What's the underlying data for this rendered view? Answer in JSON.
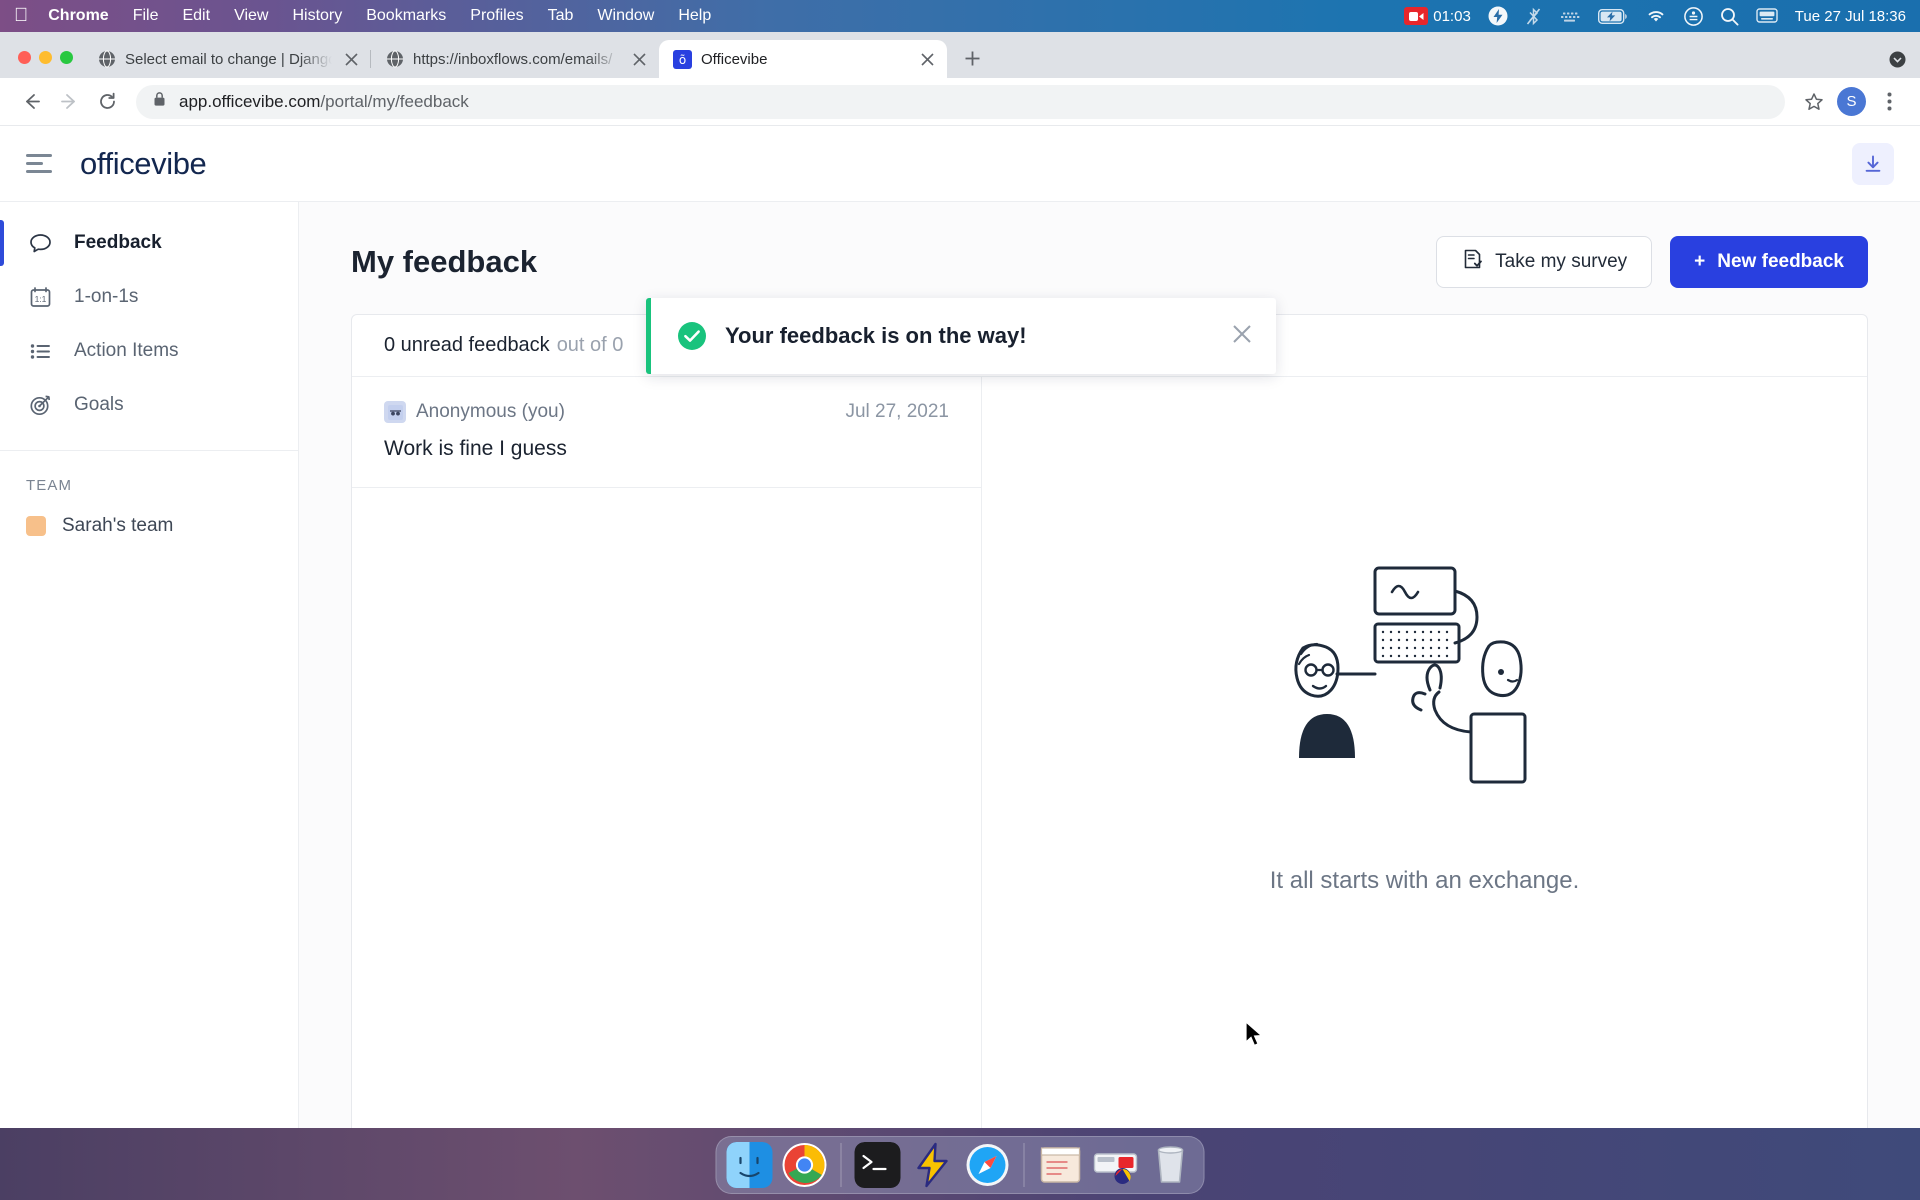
{
  "menubar": {
    "apple_icon": "apple-logo-icon",
    "items": [
      {
        "label": "Chrome",
        "bold": true
      },
      {
        "label": "File",
        "bold": false
      },
      {
        "label": "Edit",
        "bold": false
      },
      {
        "label": "View",
        "bold": false
      },
      {
        "label": "History",
        "bold": false
      },
      {
        "label": "Bookmarks",
        "bold": false
      },
      {
        "label": "Profiles",
        "bold": false
      },
      {
        "label": "Tab",
        "bold": false
      },
      {
        "label": "Window",
        "bold": false
      },
      {
        "label": "Help",
        "bold": false
      }
    ],
    "recording_time": "01:03",
    "status_icons": [
      "screen-recording-icon",
      "flash-icon",
      "bluetooth-off-icon",
      "keyboard-brightness-icon",
      "battery-charging-icon",
      "wifi-icon",
      "control-center-icon",
      "search-icon",
      "siri-icon"
    ],
    "clock": "Tue 27 Jul  18:36"
  },
  "browser": {
    "tabs": [
      {
        "title": "Select email to change | Django",
        "favicon": "globe-icon",
        "active": false
      },
      {
        "title": "https://inboxflows.com/emails/",
        "favicon": "globe-icon",
        "active": false
      },
      {
        "title": "Officevibe",
        "favicon": "officevibe-favicon",
        "active": true
      }
    ],
    "new_tab_label": "+",
    "url_host": "app.officevibe.com",
    "url_path": "/portal/my/feedback",
    "profile_initial": "S",
    "toolbar_icons": [
      "back-icon",
      "forward-icon",
      "reload-icon",
      "lock-icon",
      "bookmark-star-icon",
      "chrome-menu-icon"
    ]
  },
  "app": {
    "brand": "officevibe",
    "menu_icon": "hamburger-menu-icon",
    "download_icon": "download-icon"
  },
  "toast": {
    "message": "Your feedback is on the way!",
    "icon": "check-circle-icon",
    "close_icon": "close-icon",
    "accent_color": "#19c37d"
  },
  "sidebar": {
    "items": [
      {
        "label": "Feedback",
        "icon": "chat-bubble-icon",
        "active": true
      },
      {
        "label": "1-on-1s",
        "icon": "one-on-one-icon",
        "active": false
      },
      {
        "label": "Action Items",
        "icon": "list-icon",
        "active": false
      },
      {
        "label": "Goals",
        "icon": "target-icon",
        "active": false
      }
    ],
    "team_section_label": "TEAM",
    "teams": [
      {
        "label": "Sarah's team",
        "color": "#f7c08a"
      }
    ],
    "active_accent": "#2e4bd9"
  },
  "main": {
    "title": "My feedback",
    "take_survey_label": "Take my survey",
    "take_survey_icon": "survey-icon",
    "new_feedback_label": "New feedback",
    "new_feedback_plus": "+",
    "new_feedback_color": "#2940e0",
    "unread_count_text": "0 unread feedback",
    "out_of_text": "out of 0",
    "feedback_items": [
      {
        "author": "Anonymous (you)",
        "avatar_icon": "anonymous-avatar-icon",
        "date": "Jul 27, 2021",
        "message": "Work is fine I guess"
      }
    ],
    "empty_state_text": "It all starts with an exchange.",
    "empty_state_illustration": "two-people-exchange-illustration"
  },
  "dock": {
    "apps": [
      {
        "name": "finder-icon"
      },
      {
        "name": "chrome-icon"
      },
      {
        "name": "terminal-icon"
      },
      {
        "name": "flash-app-icon"
      },
      {
        "name": "safari-icon"
      },
      {
        "name": "notes-icon"
      },
      {
        "name": "app-store-icon"
      },
      {
        "name": "trash-icon"
      }
    ]
  }
}
